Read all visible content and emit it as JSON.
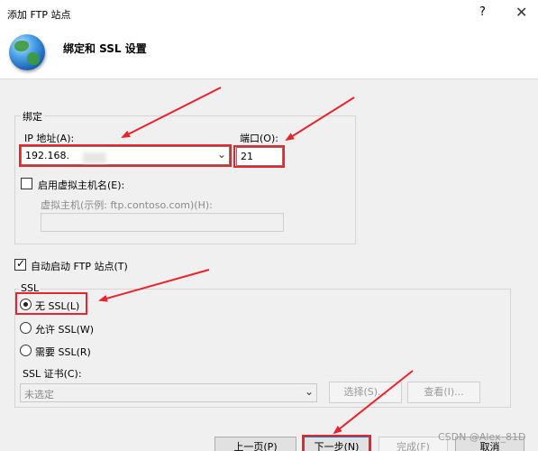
{
  "window": {
    "title": "添加 FTP 站点",
    "help_glyph": "?",
    "close_glyph": "✕"
  },
  "header": {
    "title": "绑定和 SSL 设置",
    "icon": "globe-icon"
  },
  "binding": {
    "group_label": "绑定",
    "ip_label": "IP 地址(A):",
    "ip_value": "192.168.",
    "port_label": "端口(O):",
    "port_value": "21",
    "enable_virtual_host_label": "启用虚拟主机名(E):",
    "virtual_host_label": "虚拟主机(示例: ftp.contoso.com)(H):",
    "virtual_host_value": ""
  },
  "auto_start": {
    "label": "自动启动 FTP 站点(T)",
    "checked": true
  },
  "ssl": {
    "group_label": "SSL",
    "options": [
      {
        "label": "无 SSL(L)",
        "selected": true
      },
      {
        "label": "允许 SSL(W)",
        "selected": false
      },
      {
        "label": "需要 SSL(R)",
        "selected": false
      }
    ],
    "cert_label": "SSL 证书(C):",
    "cert_value": "未选定",
    "select_button": "选择(S)...",
    "view_button": "查看(I)..."
  },
  "footer": {
    "prev_button": "上一页(P)",
    "next_button": "下一步(N)",
    "finish_button": "完成(F)",
    "cancel_button": "取消"
  },
  "watermark": "CSDN @Alex_81D",
  "colors": {
    "annotation_red": "#e8242c",
    "accent_blue": "#0078d7"
  }
}
